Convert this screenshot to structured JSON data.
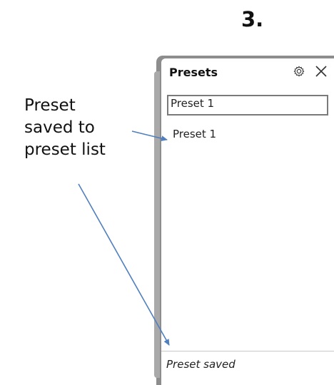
{
  "step": {
    "number": "3."
  },
  "callout": {
    "lines": [
      "Preset",
      "saved to",
      "preset list"
    ]
  },
  "panel": {
    "title": "Presets",
    "name_input_value": "Preset 1",
    "presets": [
      {
        "label": "Preset 1"
      }
    ],
    "status": "Preset saved"
  },
  "icons": {
    "settings": "gear-icon",
    "close": "close-icon"
  },
  "colors": {
    "annotation_arrow": "#4f7fbf",
    "panel_frame": "#8d8d8d",
    "input_border": "#7a7a7a"
  }
}
